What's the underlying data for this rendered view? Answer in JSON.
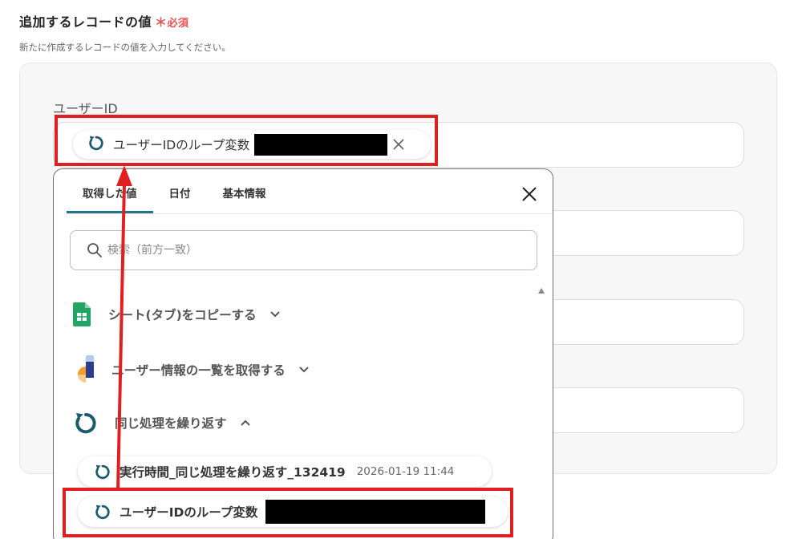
{
  "section": {
    "title": "追加するレコードの値",
    "required_mark": "＊",
    "required_text": "必須",
    "subtitle": "新たに作成するレコードの値を入力してください。"
  },
  "field": {
    "label": "ユーザーID",
    "chip_text": "ユーザーIDのループ変数"
  },
  "dropdown": {
    "tabs": [
      {
        "label": "取得した値"
      },
      {
        "label": "日付"
      },
      {
        "label": "基本情報"
      }
    ],
    "search_placeholder": "検索（前方一致）",
    "groups": [
      {
        "label": "シート(タブ)をコピーする",
        "icon": "google-sheets-icon",
        "state": "collapsed"
      },
      {
        "label": "ユーザー情報の一覧を取得する",
        "icon": "app-logo-icon",
        "state": "collapsed"
      },
      {
        "label": "同じ処理を繰り返す",
        "icon": "loop-icon",
        "state": "expanded"
      }
    ],
    "options": [
      {
        "label": "実行時間_同じ処理を繰り返す_132419",
        "date": "2026-01-19 11:44"
      },
      {
        "label": "ユーザーIDのループ変数"
      }
    ]
  },
  "colors": {
    "accent": "#24738a",
    "required": "#e8504f",
    "highlight": "#e02020"
  }
}
